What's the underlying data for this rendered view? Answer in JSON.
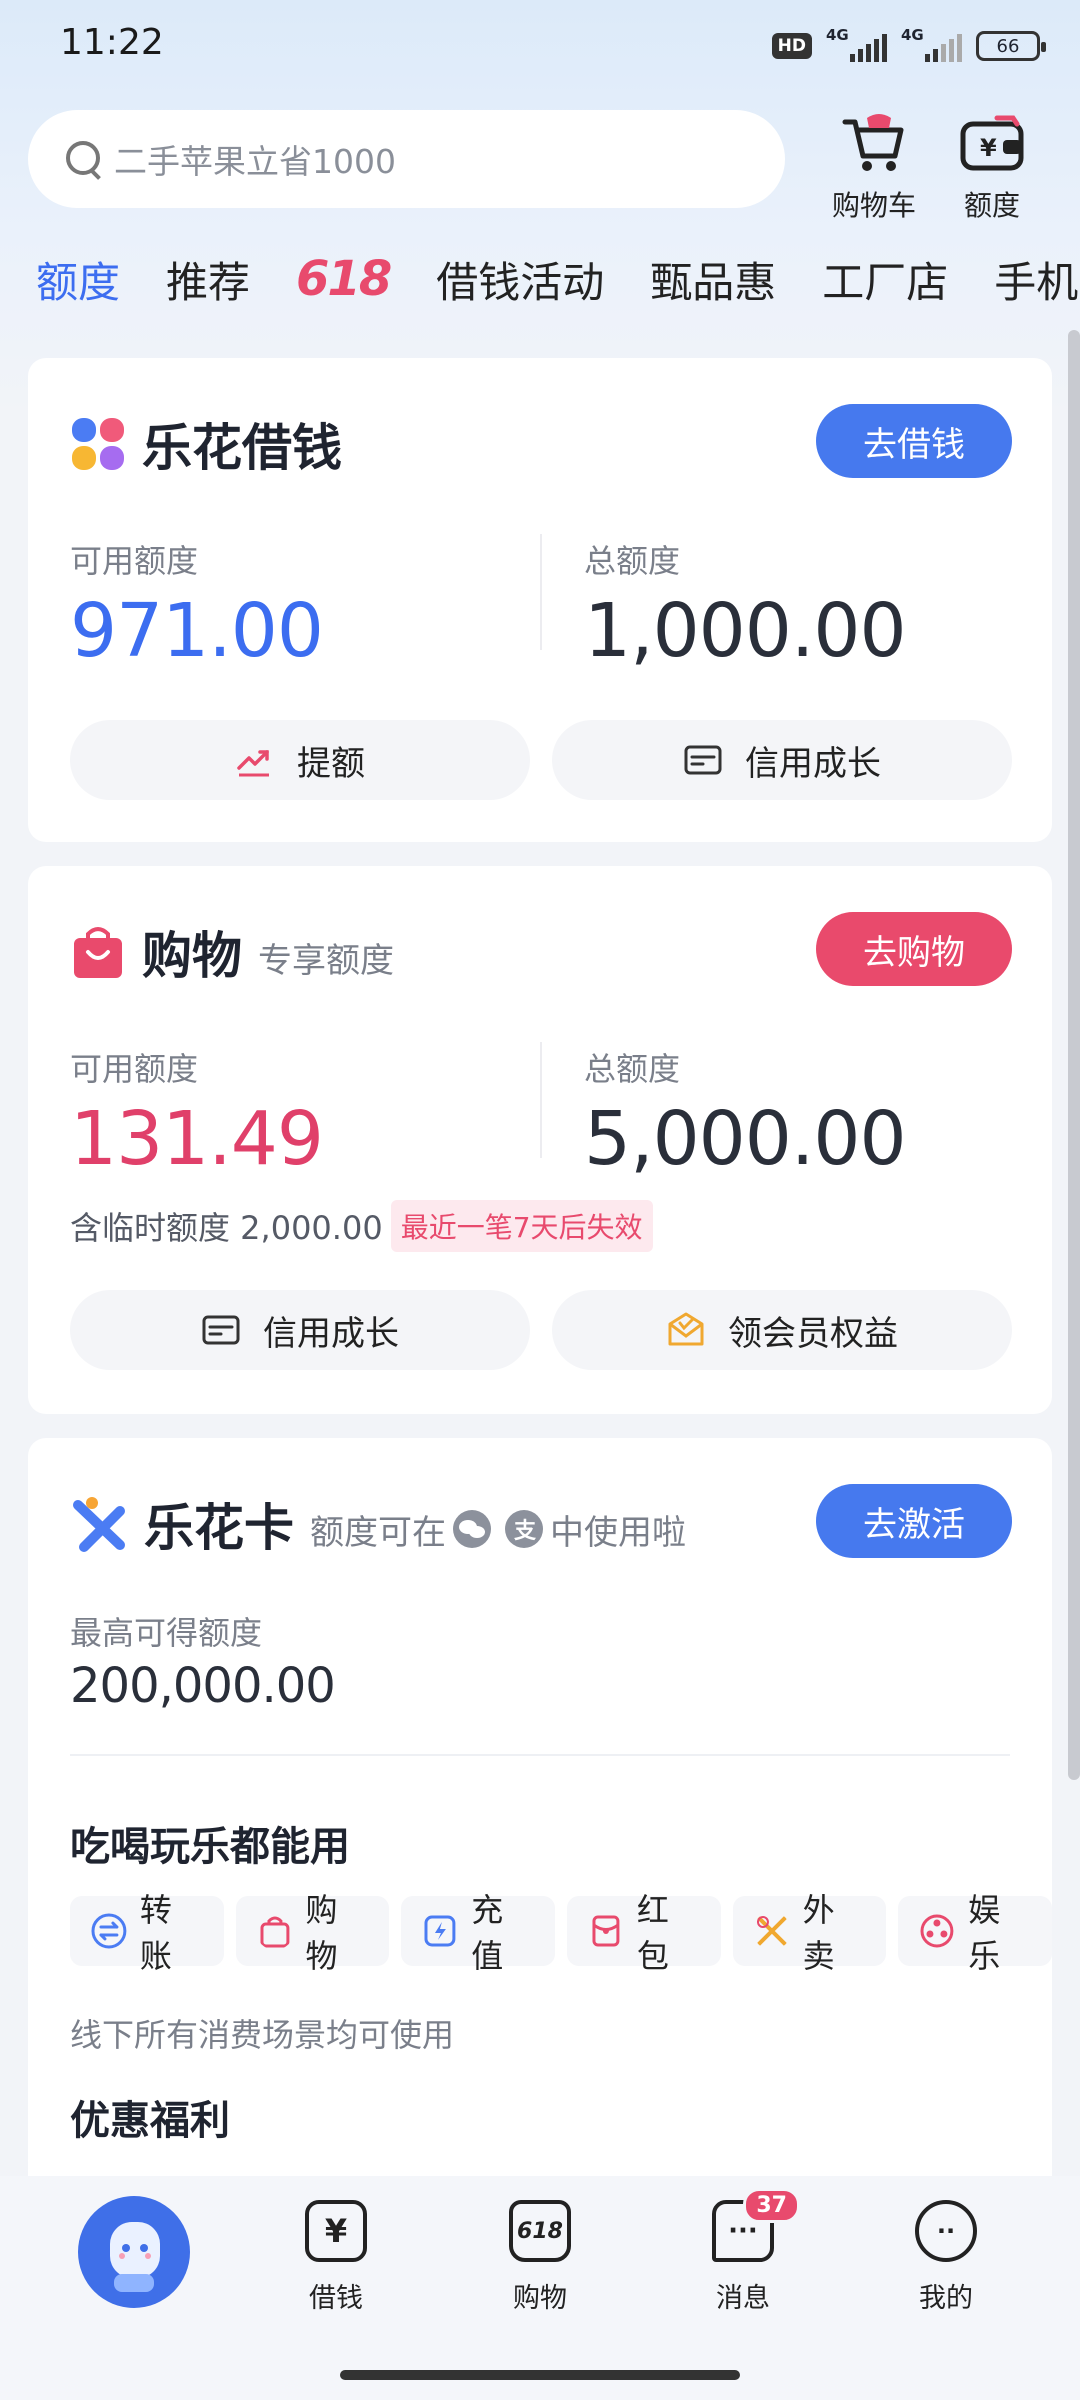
{
  "status_bar": {
    "time": "11:22",
    "hd": "HD",
    "net1": "4G",
    "net2": "4G",
    "battery": "66"
  },
  "search": {
    "placeholder": "二手苹果立省1000"
  },
  "top_actions": {
    "cart": "购物车",
    "quota": "额度"
  },
  "tabs": [
    "额度",
    "推荐",
    "618",
    "借钱活动",
    "甄品惠",
    "工厂店",
    "手机"
  ],
  "loan_card": {
    "title": "乐花借钱",
    "button": "去借钱",
    "available_label": "可用额度",
    "available_value": "971.00",
    "total_label": "总额度",
    "total_value": "1,000.00",
    "btn_raise": "提额",
    "btn_credit": "信用成长"
  },
  "shop_card": {
    "title": "购物",
    "subtitle": "专享额度",
    "button": "去购物",
    "available_label": "可用额度",
    "available_value": "131.49",
    "total_label": "总额度",
    "total_value": "5,000.00",
    "temp_note": "含临时额度 2,000.00",
    "temp_tag": "最近一笔7天后失效",
    "btn_credit": "信用成长",
    "btn_member": "领会员权益"
  },
  "card_card": {
    "title": "乐花卡",
    "subtitle_pre": "额度可在",
    "subtitle_post": "中使用啦",
    "button": "去激活",
    "max_label": "最高可得额度",
    "max_value": "200,000.00",
    "section_use": "吃喝玩乐都能用",
    "chips": [
      "转账",
      "购物",
      "充值",
      "红包",
      "外卖",
      "娱乐"
    ],
    "offline_note": "线下所有消费场景均可使用",
    "section_benefits": "优惠福利"
  },
  "bottom_nav": {
    "loan": "借钱",
    "shop": "购物",
    "messages": "消息",
    "messages_badge": "37",
    "mine": "我的"
  },
  "colors": {
    "accent_blue": "#4679ee",
    "accent_red": "#e94a6c"
  }
}
